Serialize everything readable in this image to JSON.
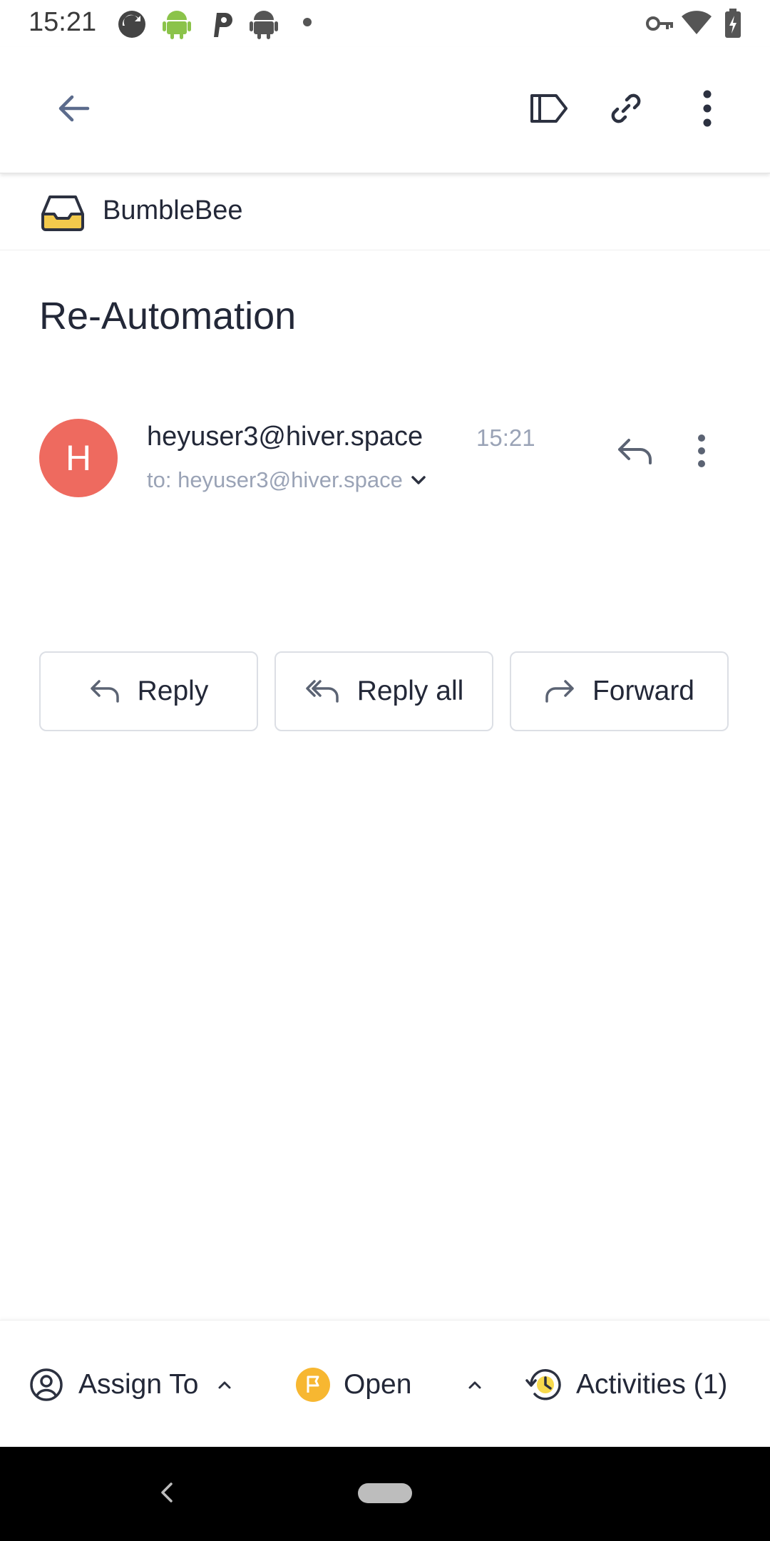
{
  "status_bar": {
    "time": "15:21"
  },
  "mailbox": {
    "name": "BumbleBee"
  },
  "subject": "Re-Automation",
  "message": {
    "avatar_letter": "H",
    "sender": "heyuser3@hiver.space",
    "time": "15:21",
    "recipients": "to: heyuser3@hiver.space"
  },
  "actions": {
    "reply": "Reply",
    "reply_all": "Reply all",
    "forward": "Forward"
  },
  "bottom_bar": {
    "assign": "Assign To",
    "status": "Open",
    "activities": "Activities (1)"
  },
  "colors": {
    "avatar": "#ee6a5f",
    "status_badge": "#f7b731",
    "mailbox_icon": "#f2c94c",
    "accent": "#5b6b8c"
  },
  "icons": [
    "back-arrow-icon",
    "label-icon",
    "link-icon",
    "more-vert-icon",
    "inbox-icon",
    "reply-icon",
    "reply-all-icon",
    "forward-icon",
    "user-circle-icon",
    "flag-icon",
    "chevron-up-icon",
    "history-icon"
  ]
}
